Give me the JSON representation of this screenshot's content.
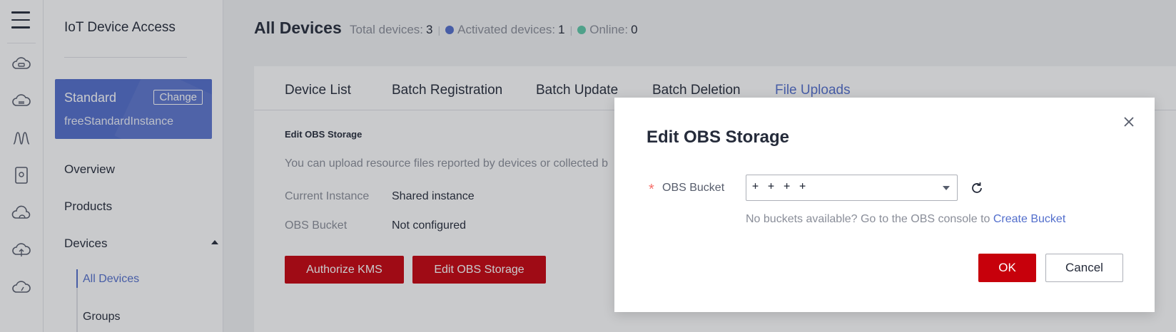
{
  "nav": {
    "title": "IoT Device Access",
    "instance": {
      "name": "Standard",
      "change_label": "Change",
      "id": "freeStandardInstance"
    },
    "items": [
      {
        "label": "Overview"
      },
      {
        "label": "Products"
      },
      {
        "label": "Devices"
      }
    ],
    "sub_items": [
      {
        "label": "All Devices",
        "active": true
      },
      {
        "label": "Groups"
      }
    ]
  },
  "header": {
    "title": "All Devices",
    "total_label": "Total devices:",
    "total_value": "3",
    "activated_label": "Activated devices:",
    "activated_value": "1",
    "online_label": "Online:",
    "online_value": "0",
    "colors": {
      "activated": "#526ecc",
      "online": "#5cc9a7"
    }
  },
  "tabs": [
    {
      "label": "Device List"
    },
    {
      "label": "Batch Registration"
    },
    {
      "label": "Batch Update"
    },
    {
      "label": "Batch Deletion"
    },
    {
      "label": "File Uploads",
      "active": true
    }
  ],
  "content": {
    "section_title": "Edit OBS Storage",
    "description": "You can upload resource files reported by devices or collected b",
    "current_instance_label": "Current Instance",
    "current_instance_value": "Shared instance",
    "obs_bucket_label": "OBS Bucket",
    "obs_bucket_value": "Not configured",
    "authorize_kms_label": "Authorize KMS",
    "edit_obs_label": "Edit OBS Storage"
  },
  "modal": {
    "title": "Edit OBS Storage",
    "required_mark": "*",
    "field_label": "OBS Bucket",
    "select_value": "+ + + +",
    "hint_text": "No buckets available? Go to the OBS console to ",
    "hint_link": "Create Bucket",
    "ok_label": "OK",
    "cancel_label": "Cancel"
  },
  "icons": {
    "menu": "hamburger-menu-icon",
    "rail": [
      "cloud-device-icon",
      "cloud-hub-icon",
      "waveform-icon",
      "phone-device-icon",
      "cloud-outline-icon",
      "cloud-upload-icon",
      "cloud-speed-icon"
    ],
    "close": "close-icon",
    "refresh": "refresh-icon"
  },
  "colors": {
    "brand_red": "#c7000b",
    "accent_blue": "#526ecc"
  }
}
